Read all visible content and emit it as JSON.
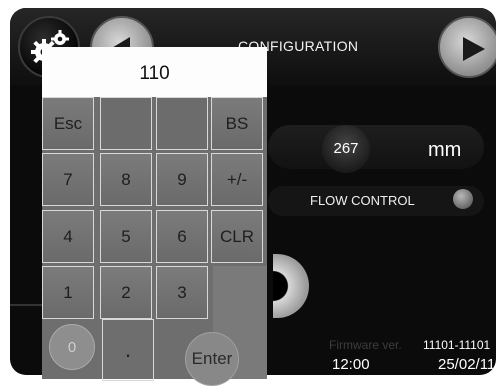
{
  "header": {
    "title": "CONFIGURATION",
    "settings_icon": "gears-icon",
    "back_icon": "triangle-left-icon",
    "forward_icon": "triangle-right-icon"
  },
  "main": {
    "value": "267",
    "unit": "mm",
    "flow_control_label": "FLOW CONTROL"
  },
  "footer": {
    "firmware_label": "Firmware ver.",
    "firmware_value": "11101-11101",
    "time": "12:00",
    "date": "25/02/11"
  },
  "keypad": {
    "display_value": "110",
    "keys": {
      "esc": "Esc",
      "bs": "BS",
      "k7": "7",
      "k8": "8",
      "k9": "9",
      "plus_minus": "+/-",
      "k4": "4",
      "k5": "5",
      "k6": "6",
      "clr": "CLR",
      "k1": "1",
      "k2": "2",
      "k3": "3",
      "k0": "0",
      "dot": ".",
      "enter": "Enter"
    }
  },
  "colors": {
    "screen_bg": "#0b0b0b",
    "keypad_bg": "#6e6e6e",
    "display_bg": "#fdfdfd",
    "text_light": "#ffffff"
  }
}
